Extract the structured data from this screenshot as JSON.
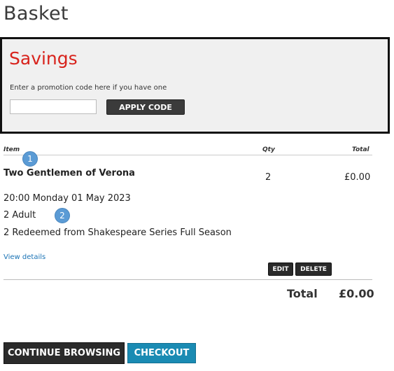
{
  "page": {
    "title": "Basket"
  },
  "savings": {
    "heading": "Savings",
    "promo_label": "Enter a promotion code here if you have one",
    "promo_value": "",
    "apply_label": "APPLY CODE"
  },
  "table": {
    "headers": {
      "item": "Item",
      "qty": "Qty",
      "total": "Total"
    }
  },
  "markers": [
    "1",
    "2"
  ],
  "item": {
    "name": "Two Gentlemen of Verona",
    "qty": "2",
    "total": "£0.00",
    "datetime": "20:00 Monday 01 May 2023",
    "tickets": "2 Adult",
    "redeemed": "2 Redeemed from Shakespeare Series Full Season",
    "view_details": "View details",
    "edit_label": "EDIT",
    "delete_label": "DELETE"
  },
  "summary": {
    "total_label": "Total",
    "total_value": "£0.00"
  },
  "actions": {
    "continue_label": "CONTINUE BROWSING",
    "checkout_label": "CHECKOUT"
  },
  "colors": {
    "accent_red": "#d8231c",
    "checkout_blue": "#1a8bb3",
    "marker_blue": "#5b9bd5"
  }
}
